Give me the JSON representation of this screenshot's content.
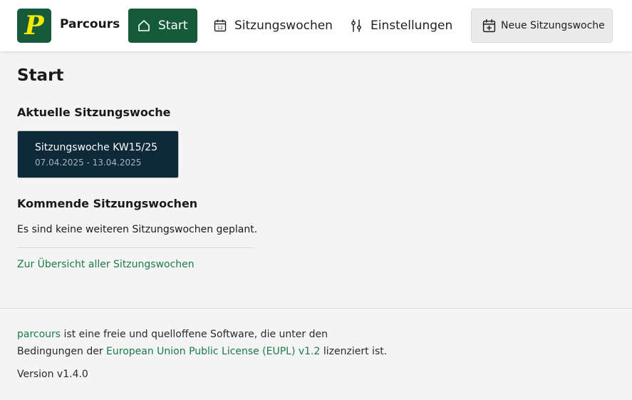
{
  "brand": {
    "logo_letter": "P",
    "name": "Parcours"
  },
  "nav": {
    "start": "Start",
    "weeks": "Sitzungswochen",
    "weeks_icon_day": "12",
    "settings": "Einstellungen"
  },
  "new_week_button": "Neue Sitzungswoche",
  "main": {
    "page_title": "Start",
    "current_title": "Aktuelle Sitzungswoche",
    "current_card": {
      "title": "Sitzungswoche KW15/25",
      "dates": "07.04.2025 - 13.04.2025"
    },
    "upcoming_title": "Kommende Sitzungswochen",
    "upcoming_empty": "Es sind keine weiteren Sitzungswochen geplant.",
    "overview_link": "Zur Übersicht aller Sitzungswochen"
  },
  "footer": {
    "project_link": "parcours",
    "text_a": " ist eine freie und quelloffene Software, die unter den",
    "text_b": "Bedingungen der ",
    "license_link": "European Union Public License (EUPL) v1.2",
    "text_c": " lizenziert ist.",
    "version": "Version v1.4.0"
  },
  "colors": {
    "primary": "#155b3a",
    "logo_letter": "#f5e800",
    "card_bg": "#0e2a3a",
    "link": "#1b7a4a",
    "background": "#f4f4f4"
  },
  "icons": {
    "start": "home-icon",
    "weeks": "calendar-icon",
    "settings": "sliders-icon",
    "new_week": "calendar-plus-icon"
  }
}
